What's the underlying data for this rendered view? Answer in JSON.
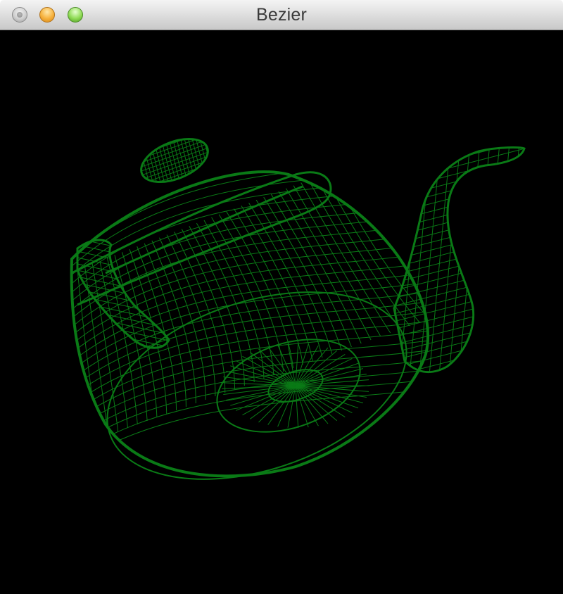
{
  "window": {
    "title": "Bezier",
    "buttons": [
      "close-button",
      "minimize-button",
      "zoom-button"
    ]
  },
  "canvas": {
    "background_color": "#000000",
    "wireframe_color": "#0a7a16",
    "object": "teapot-wireframe"
  },
  "icons": {
    "close": "close-icon",
    "minimize": "minimize-icon",
    "zoom": "zoom-icon"
  }
}
